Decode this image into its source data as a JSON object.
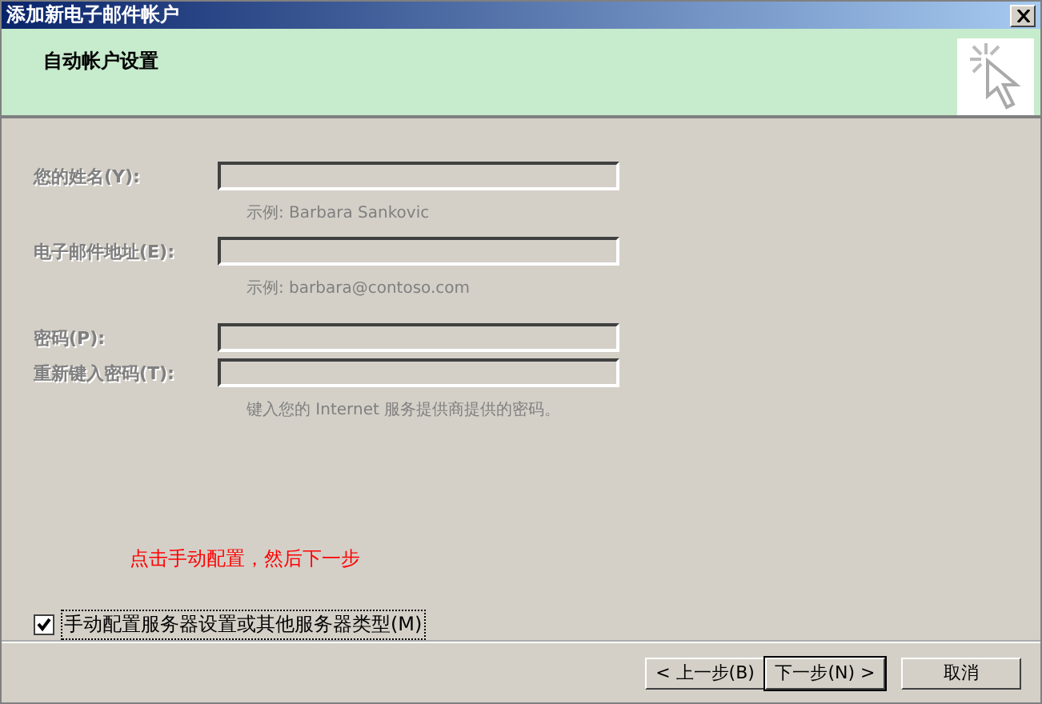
{
  "window": {
    "title": "添加新电子邮件帐户"
  },
  "header": {
    "title": "自动帐户设置"
  },
  "fields": [
    {
      "label": "您的姓名(Y):",
      "disabled": true,
      "hint": "示例: Barbara Sankovic"
    },
    {
      "label": "电子邮件地址(E):",
      "disabled": true,
      "hint": "示例: barbara@contoso.com"
    },
    {
      "label": "密码(P):",
      "disabled": true
    },
    {
      "label": "重新键入密码(T):",
      "disabled": true,
      "hint": "键入您的 Internet 服务提供商提供的密码。"
    }
  ],
  "annotation": "点击手动配置，然后下一步",
  "manual_config": {
    "label": "手动配置服务器设置或其他服务器类型(M)",
    "checked": true
  },
  "buttons": [
    {
      "label": "< 上一步(B)",
      "default": false
    },
    {
      "label": "下一步(N) >",
      "default": true
    },
    {
      "label": "取消",
      "default": false
    }
  ]
}
